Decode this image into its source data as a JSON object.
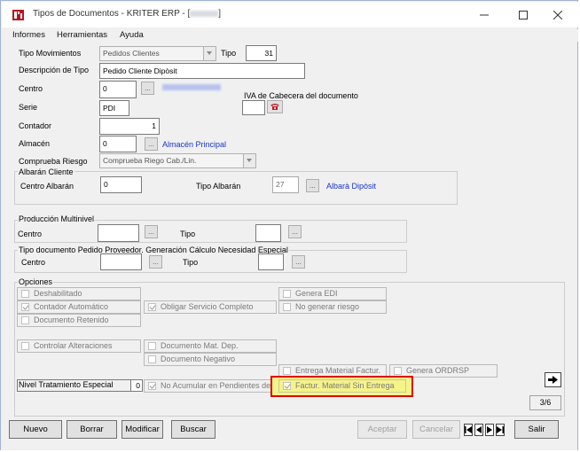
{
  "window": {
    "title": "Tipos de Documentos - KRITER ERP - [",
    "title_suffix": "]",
    "minimize_icon": "minimize-icon",
    "maximize_icon": "maximize-icon",
    "close_icon": "close-icon"
  },
  "menu": [
    "Informes",
    "Herramientas",
    "Ayuda"
  ],
  "form": {
    "tipo_movimientos_label": "Tipo Movimientos",
    "tipo_movimientos_value": "Pedidos Clientes",
    "tipo_label": "Tipo",
    "tipo_value": "31",
    "descripcion_label": "Descripción de Tipo",
    "descripcion_value": "Pedido Cliente Dipòsit",
    "centro_label": "Centro",
    "centro_value": "0",
    "iva_label": "IVA de Cabecera del documento",
    "serie_label": "Serie",
    "serie_value": "PDI",
    "contador_label": "Contador",
    "contador_value": "1",
    "almacen_label": "Almacén",
    "almacen_value": "0",
    "almacen_link": "Almacén Principal",
    "comprueba_label": "Comprueba Riesgo",
    "comprueba_value": "Comprueba Riego Cab./Lin.",
    "lookup_label": "..."
  },
  "albaran": {
    "group_label": "Albarán Cliente",
    "centro_label": "Centro Albarán",
    "centro_value": "0",
    "tipo_label": "Tipo Albarán",
    "tipo_value": "27",
    "tipo_link": "Albarà Dipòsit"
  },
  "produccion": {
    "group_label": "Producción Multinivel",
    "centro_label": "Centro",
    "tipo_label": "Tipo"
  },
  "proveedor": {
    "group_label": "Tipo documento Pedido Proveedor. Generación Cálculo Necesidad Especial",
    "centro_label": "Centro",
    "tipo_label": "Tipo"
  },
  "opciones": {
    "group_label": "Opciones",
    "deshabilitado": "Deshabilitado",
    "contador_automatico": "Contador Automático",
    "documento_retenido": "Documento Retenido",
    "obligar_servicio": "Obligar Servicio Completo",
    "genera_edi": "Genera EDI",
    "no_generar_riesgo": "No generar riesgo",
    "controlar_alteraciones": "Controlar Alteraciones",
    "documento_mat_dep": "Documento Mat. Dep.",
    "documento_negativo": "Documento Negativo",
    "entrega_material": "Entrega Material Factur.",
    "genera_ordrsp": "Genera ORDRSP",
    "nivel_label": "Nivel Tratamiento Especial",
    "nivel_value": "0",
    "no_acumular": "No Acumular en Pendientes de S",
    "factur_material": "Factur. Material Sin Entrega",
    "arrow_icon": "arrow-right-icon",
    "page_indicator": "3/6"
  },
  "buttons": {
    "nuevo": "Nuevo",
    "borrar": "Borrar",
    "modificar": "Modificar",
    "buscar": "Buscar",
    "aceptar": "Aceptar",
    "cancelar": "Cancelar",
    "salir": "Salir",
    "nav_first": "first-record-icon",
    "nav_prev": "previous-record-icon",
    "nav_next": "next-record-icon",
    "nav_last": "last-record-icon"
  },
  "colors": {
    "link": "#1a34c8",
    "highlight_border": "#e00000",
    "highlight_fill": "#f5f38a"
  }
}
